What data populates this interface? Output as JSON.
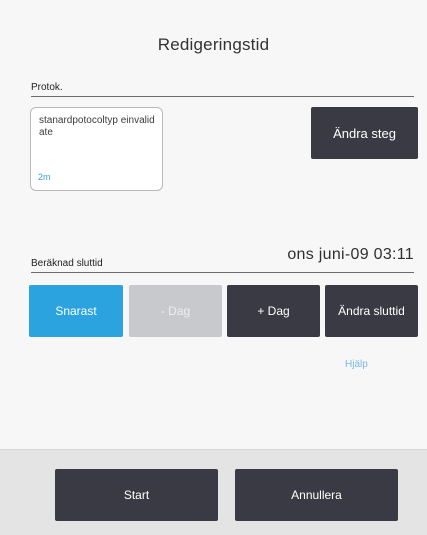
{
  "dialog": {
    "title": "Redigeringstid"
  },
  "protocol": {
    "section_label": "Protok.",
    "name": "stanardpotocoltyp einvalidate",
    "duration": "2m",
    "edit_step_label": "Ändra steg"
  },
  "end_time": {
    "label": "Beräknad sluttid",
    "value": "ons juni-09 03:11",
    "buttons": {
      "asap": "Snarast",
      "minus_day": "- Dag",
      "plus_day": "+ Dag",
      "change_end": "Ändra sluttid"
    },
    "help_label": "Hjälp"
  },
  "footer": {
    "start_label": "Start",
    "cancel_label": "Annullera"
  },
  "colors": {
    "accent": "#2aa3df",
    "dark_button": "#3a3a44",
    "disabled_button": "#c7c9cc",
    "link": "#78b8e6"
  }
}
